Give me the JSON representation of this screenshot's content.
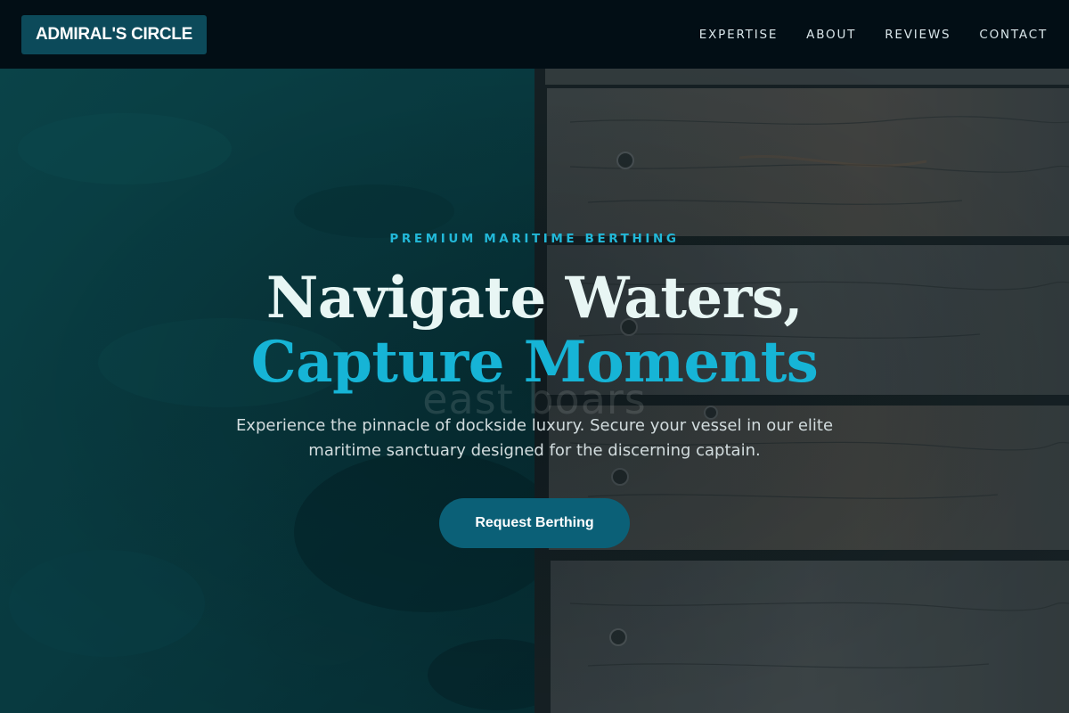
{
  "header": {
    "brand": "ADMIRAL'S CIRCLE",
    "nav": [
      {
        "label": "EXPERTISE"
      },
      {
        "label": "ABOUT"
      },
      {
        "label": "REVIEWS"
      },
      {
        "label": "CONTACT"
      }
    ]
  },
  "hero": {
    "eyebrow": "PREMIUM MARITIME BERTHING",
    "headline_line1": "Navigate Waters,",
    "headline_line2": "Capture Moments",
    "ghost_text": "east boars",
    "subtitle": "Experience the pinnacle of dockside luxury. Secure your vessel in our elite maritime sanctuary designed for the discerning captain.",
    "cta_label": "Request Berthing",
    "background_image": "aerial view of teal water beside a weathered wooden dock"
  },
  "colors": {
    "header_bg": "#020e15",
    "brand_bg": "#0c4a5a",
    "accent": "#16b4d6",
    "cta_bg": "#0b6077",
    "headline": "#e8f6f4"
  }
}
